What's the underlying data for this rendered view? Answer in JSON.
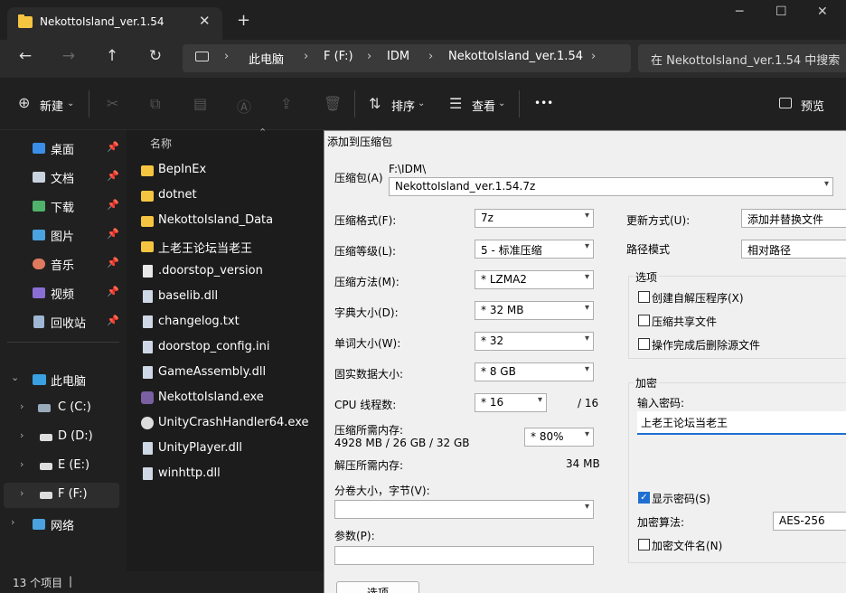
{
  "tab": {
    "title": "NekottoIsland_ver.1.54",
    "close": "✕",
    "new": "+"
  },
  "window_buttons": {
    "minimize": "─",
    "maximize": "☐",
    "close": "✕"
  },
  "nav": {
    "back": "←",
    "forward": "→",
    "up": "↑",
    "refresh": "↻",
    "more_crumb": "›"
  },
  "breadcrumbs": [
    "此电脑",
    "F (F:)",
    "IDM",
    "NekottoIsland_ver.1.54"
  ],
  "search": {
    "placeholder": "在 NekottoIsland_ver.1.54 中搜索"
  },
  "toolbar": {
    "new_label": "新建",
    "sort_label": "排序",
    "view_label": "查看",
    "more": "•••",
    "preview_label": "预览"
  },
  "sidebar": {
    "quick": [
      {
        "label": "桌面",
        "icon": "desktop-icon",
        "color": "#3b8ee8"
      },
      {
        "label": "文档",
        "icon": "document-icon",
        "color": "#c9d3e0"
      },
      {
        "label": "下载",
        "icon": "download-icon",
        "color": "#4fb36b"
      },
      {
        "label": "图片",
        "icon": "pictures-icon",
        "color": "#4aa3df"
      },
      {
        "label": "音乐",
        "icon": "music-icon",
        "color": "#e07a5f"
      },
      {
        "label": "视频",
        "icon": "video-icon",
        "color": "#8b6ed4"
      },
      {
        "label": "回收站",
        "icon": "recycle-bin-icon",
        "color": "#9fb7d4"
      }
    ],
    "this_pc": "此电脑",
    "drives": [
      "C (C:)",
      "D (D:)",
      "E (E:)",
      "F (F:)"
    ],
    "network": "网络"
  },
  "file_list": {
    "column": "名称",
    "items": [
      {
        "name": "BepInEx",
        "type": "folder"
      },
      {
        "name": "dotnet",
        "type": "folder"
      },
      {
        "name": "NekottoIsland_Data",
        "type": "folder"
      },
      {
        "name": "上老王论坛当老王",
        "type": "folder"
      },
      {
        "name": ".doorstop_version",
        "type": "file"
      },
      {
        "name": "baselib.dll",
        "type": "dll"
      },
      {
        "name": "changelog.txt",
        "type": "text"
      },
      {
        "name": "doorstop_config.ini",
        "type": "text"
      },
      {
        "name": "GameAssembly.dll",
        "type": "dll"
      },
      {
        "name": "NekottoIsland.exe",
        "type": "exe"
      },
      {
        "name": "UnityCrashHandler64.exe",
        "type": "exe"
      },
      {
        "name": "UnityPlayer.dll",
        "type": "dll"
      },
      {
        "name": "winhttp.dll",
        "type": "dll"
      }
    ]
  },
  "status": {
    "count": "13 个项目",
    "sep": "|"
  },
  "dialog": {
    "title": "添加到压缩包",
    "archive_label": "压缩包(A)",
    "archive_dir": "F:\\IDM\\",
    "archive_name": "NekottoIsland_ver.1.54.7z",
    "format_label": "压缩格式(F):",
    "format_value": "7z",
    "level_label": "压缩等级(L):",
    "level_value": "5 - 标准压缩",
    "method_label": "压缩方法(M):",
    "method_value": "* LZMA2",
    "dict_label": "字典大小(D):",
    "dict_value": "* 32 MB",
    "word_label": "单词大小(W):",
    "word_value": "* 32",
    "solid_label": "固实数据大小:",
    "solid_value": "* 8 GB",
    "threads_label": "CPU 线程数:",
    "threads_value": "* 16",
    "threads_total": "/ 16",
    "mem_label": "压缩所需内存:",
    "mem_detail": "4928 MB / 26 GB / 32 GB",
    "mem_value": "* 80%",
    "decomp_label": "解压所需内存:",
    "decomp_value": "34 MB",
    "split_label": "分卷大小，字节(V):",
    "split_value": "",
    "params_label": "参数(P):",
    "params_value": "",
    "options_button": "选项",
    "update_label": "更新方式(U):",
    "update_value": "添加并替换文件",
    "path_label": "路径模式",
    "path_value": "相对路径",
    "options_group": "选项",
    "opt_sfx": "创建自解压程序(X)",
    "opt_shared": "压缩共享文件",
    "opt_delete": "操作完成后删除源文件",
    "enc_group": "加密",
    "pw_label": "输入密码:",
    "pw_value": "上老王论坛当老王",
    "show_pw": "显示密码(S)",
    "enc_method_label": "加密算法:",
    "enc_method_value": "AES-256",
    "enc_names": "加密文件名(N)"
  }
}
